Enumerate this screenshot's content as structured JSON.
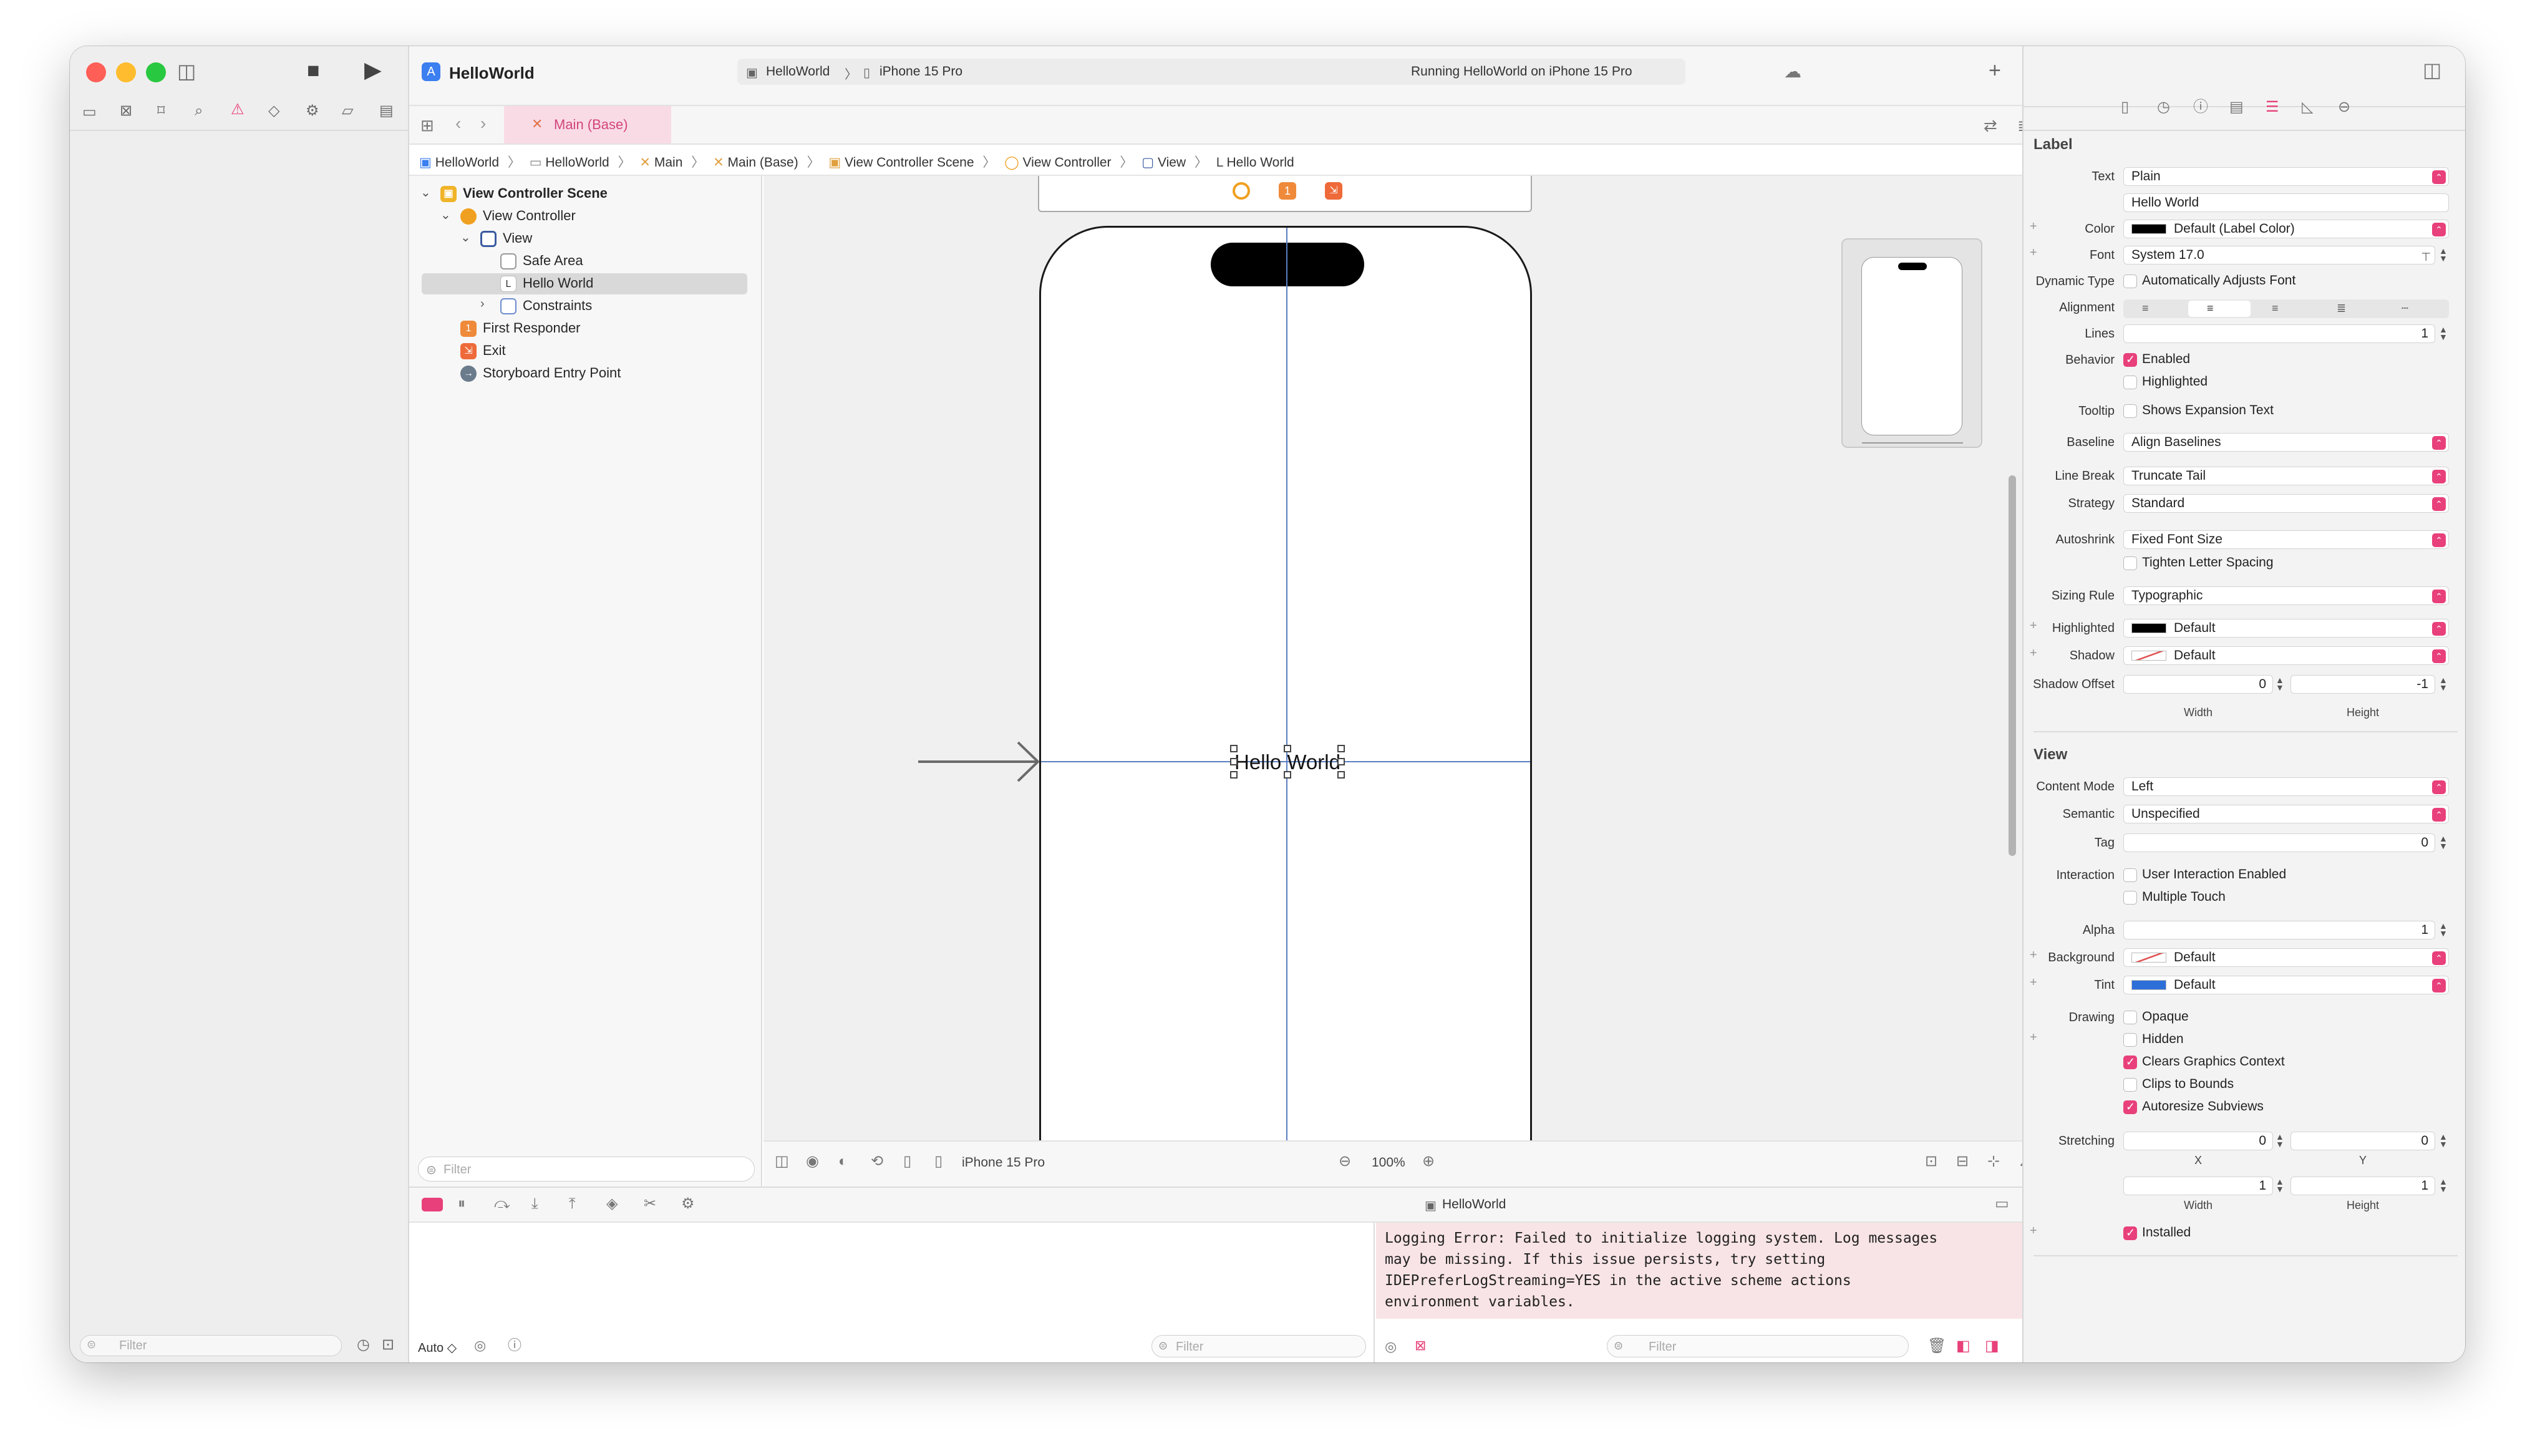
{
  "window": {
    "traffic_lights": [
      "#ff5f57",
      "#febc2e",
      "#28c840"
    ]
  },
  "toolbar": {
    "project_name": "HelloWorld",
    "scheme": "HelloWorld",
    "destination": "iPhone 15 Pro",
    "status": "Running HelloWorld on iPhone 15 Pro",
    "add_symbol": "+"
  },
  "tab": {
    "label": "Main (Base)"
  },
  "jumpbar": {
    "items": [
      "HelloWorld",
      "HelloWorld",
      "Main",
      "Main (Base)",
      "View Controller Scene",
      "View Controller",
      "View",
      "Hello World"
    ]
  },
  "outline": {
    "scene": "View Controller Scene",
    "vc": "View Controller",
    "view": "View",
    "safe_area": "Safe Area",
    "label": "Hello World",
    "constraints": "Constraints",
    "first_responder": "First Responder",
    "exit": "Exit",
    "entry": "Storyboard Entry Point",
    "filter_placeholder": "Filter"
  },
  "left": {
    "filter_placeholder": "Filter"
  },
  "canvas": {
    "label_text": "Hello World"
  },
  "canvasbar": {
    "device": "iPhone 15 Pro",
    "zoom": "100%"
  },
  "debug": {
    "target": "HelloWorld",
    "auto": "Auto ◇",
    "filter_placeholder": "Filter",
    "console_filter": "Filter"
  },
  "console": {
    "text": "Logging Error: Failed to initialize logging system. Log messages\nmay be missing. If this issue persists, try setting\nIDEPreferLogStreaming=YES in the active scheme actions\nenvironment variables."
  },
  "inspector": {
    "label_section": "Label",
    "view_section": "View",
    "text_label": "Text",
    "text_value": "Plain",
    "text_content": "Hello World",
    "color_label": "Color",
    "color_value": "Default (Label Color)",
    "font_label": "Font",
    "font_value": "System 17.0",
    "dynamic_label": "Dynamic Type",
    "dynamic_value": "Automatically Adjusts Font",
    "alignment_label": "Alignment",
    "lines_label": "Lines",
    "lines_value": "1",
    "behavior_label": "Behavior",
    "enabled": "Enabled",
    "highlighted_chk": "Highlighted",
    "tooltip_label": "Tooltip",
    "tooltip_value": "Shows Expansion Text",
    "baseline_label": "Baseline",
    "baseline_value": "Align Baselines",
    "linebreak_label": "Line Break",
    "linebreak_value": "Truncate Tail",
    "strategy_label": "Strategy",
    "strategy_value": "Standard",
    "autoshrink_label": "Autoshrink",
    "autoshrink_value": "Fixed Font Size",
    "tighten": "Tighten Letter Spacing",
    "sizing_label": "Sizing Rule",
    "sizing_value": "Typographic",
    "highlighted_label": "Highlighted",
    "highlighted_value": "Default",
    "shadow_label": "Shadow",
    "shadow_value": "Default",
    "shadow_offset_label": "Shadow Offset",
    "shadow_w": "0",
    "shadow_h": "-1",
    "width_sub": "Width",
    "height_sub": "Height",
    "content_mode_label": "Content Mode",
    "content_mode_value": "Left",
    "semantic_label": "Semantic",
    "semantic_value": "Unspecified",
    "tag_label": "Tag",
    "tag_value": "0",
    "interaction_label": "Interaction",
    "user_interaction": "User Interaction Enabled",
    "multiple_touch": "Multiple Touch",
    "alpha_label": "Alpha",
    "alpha_value": "1",
    "background_label": "Background",
    "background_value": "Default",
    "tint_label": "Tint",
    "tint_value": "Default",
    "drawing_label": "Drawing",
    "opaque": "Opaque",
    "hidden": "Hidden",
    "clears": "Clears Graphics Context",
    "clips": "Clips to Bounds",
    "autoresize": "Autoresize Subviews",
    "stretching_label": "Stretching",
    "stretch_x": "0",
    "stretch_y": "0",
    "x_sub": "X",
    "y_sub": "Y",
    "stretch_w": "1",
    "stretch_h": "1",
    "installed": "Installed"
  },
  "colors": {
    "accent": "#e8407a",
    "tab_bg": "#f9dbe6",
    "selection": "#d9d9d9",
    "console_bg": "#f8e4e6",
    "tint": "#2d6fd8"
  }
}
